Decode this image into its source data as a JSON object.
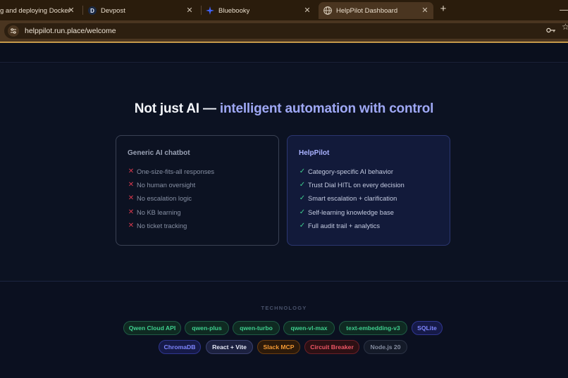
{
  "browser": {
    "tabs": [
      {
        "title": "g and deploying Docker",
        "favicon": "none"
      },
      {
        "title": "Devpost",
        "favicon": "devpost-d-icon"
      },
      {
        "title": "Bluebooky",
        "favicon": "bluebooky-star-icon"
      },
      {
        "title": "HelpPilot Dashboard",
        "favicon": "globe-icon",
        "active": true
      }
    ],
    "close_glyph": "✕",
    "new_tab_glyph": "+",
    "minimize_glyph": "—",
    "url": "helppilot.run.place/welcome",
    "theme_color": "#4a3520"
  },
  "comparison": {
    "heading_plain": "Not just AI —",
    "heading_accent": "intelligent automation with control",
    "generic": {
      "title": "Generic AI chatbot",
      "mark": "✕",
      "items": [
        "One-size-fits-all responses",
        "No human oversight",
        "No escalation logic",
        "No KB learning",
        "No ticket tracking"
      ]
    },
    "helppilot": {
      "title": "HelpPilot",
      "mark": "✓",
      "items": [
        "Category-specific AI behavior",
        "Trust Dial HITL on every decision",
        "Smart escalation + clarification",
        "Self-learning knowledge base",
        "Full audit trail + analytics"
      ]
    }
  },
  "technology": {
    "label": "TECHNOLOGY",
    "chips": [
      {
        "label": "Qwen Cloud API",
        "style": "green"
      },
      {
        "label": "qwen-plus",
        "style": "green"
      },
      {
        "label": "qwen-turbo",
        "style": "green"
      },
      {
        "label": "qwen-vl-max",
        "style": "green"
      },
      {
        "label": "text-embedding-v3",
        "style": "green"
      },
      {
        "label": "SQLite",
        "style": "indigo"
      },
      {
        "label": "ChromaDB",
        "style": "indigo"
      },
      {
        "label": "React + Vite",
        "style": "white"
      },
      {
        "label": "Slack MCP",
        "style": "orange"
      },
      {
        "label": "Circuit Breaker",
        "style": "red"
      },
      {
        "label": "Node.js 20",
        "style": "gray"
      }
    ]
  }
}
